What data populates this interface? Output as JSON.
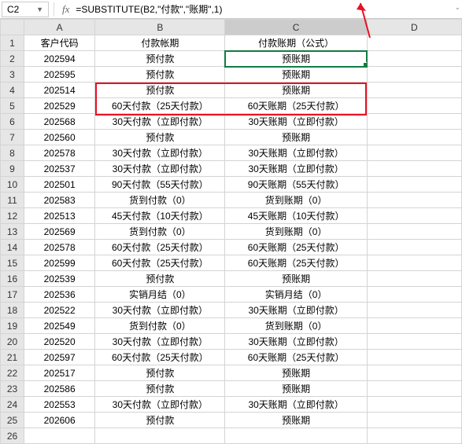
{
  "nameBox": "C2",
  "formula": "=SUBSTITUTE(B2,\"付款\",\"账期\",1)",
  "colHeaders": [
    "A",
    "B",
    "C",
    "D"
  ],
  "headerRow": [
    "客户代码",
    "付款帐期",
    "付款账期（公式）",
    ""
  ],
  "rows": [
    {
      "n": 2,
      "a": "202594",
      "b": "预付款",
      "c": "预账期"
    },
    {
      "n": 3,
      "a": "202595",
      "b": "预付款",
      "c": "预账期"
    },
    {
      "n": 4,
      "a": "202514",
      "b": "预付款",
      "c": "预账期"
    },
    {
      "n": 5,
      "a": "202529",
      "b": "60天付款（25天付款）",
      "c": "60天账期（25天付款）"
    },
    {
      "n": 6,
      "a": "202568",
      "b": "30天付款（立即付款）",
      "c": "30天账期（立即付款）"
    },
    {
      "n": 7,
      "a": "202560",
      "b": "预付款",
      "c": "预账期"
    },
    {
      "n": 8,
      "a": "202578",
      "b": "30天付款（立即付款）",
      "c": "30天账期（立即付款）"
    },
    {
      "n": 9,
      "a": "202537",
      "b": "30天付款（立即付款）",
      "c": "30天账期（立即付款）"
    },
    {
      "n": 10,
      "a": "202501",
      "b": "90天付款（55天付款）",
      "c": "90天账期（55天付款）"
    },
    {
      "n": 11,
      "a": "202583",
      "b": "货到付款（0）",
      "c": "货到账期（0）"
    },
    {
      "n": 12,
      "a": "202513",
      "b": "45天付款（10天付款）",
      "c": "45天账期（10天付款）"
    },
    {
      "n": 13,
      "a": "202569",
      "b": "货到付款（0）",
      "c": "货到账期（0）"
    },
    {
      "n": 14,
      "a": "202578",
      "b": "60天付款（25天付款）",
      "c": "60天账期（25天付款）"
    },
    {
      "n": 15,
      "a": "202599",
      "b": "60天付款（25天付款）",
      "c": "60天账期（25天付款）"
    },
    {
      "n": 16,
      "a": "202539",
      "b": "预付款",
      "c": "预账期"
    },
    {
      "n": 17,
      "a": "202536",
      "b": "实销月结（0）",
      "c": "实销月结（0）"
    },
    {
      "n": 18,
      "a": "202522",
      "b": "30天付款（立即付款）",
      "c": "30天账期（立即付款）"
    },
    {
      "n": 19,
      "a": "202549",
      "b": "货到付款（0）",
      "c": "货到账期（0）"
    },
    {
      "n": 20,
      "a": "202520",
      "b": "30天付款（立即付款）",
      "c": "30天账期（立即付款）"
    },
    {
      "n": 21,
      "a": "202597",
      "b": "60天付款（25天付款）",
      "c": "60天账期（25天付款）"
    },
    {
      "n": 22,
      "a": "202517",
      "b": "预付款",
      "c": "预账期"
    },
    {
      "n": 23,
      "a": "202586",
      "b": "预付款",
      "c": "预账期"
    },
    {
      "n": 24,
      "a": "202553",
      "b": "30天付款（立即付款）",
      "c": "30天账期（立即付款）"
    },
    {
      "n": 25,
      "a": "202606",
      "b": "预付款",
      "c": "预账期"
    },
    {
      "n": 26,
      "a": "",
      "b": "",
      "c": ""
    }
  ]
}
